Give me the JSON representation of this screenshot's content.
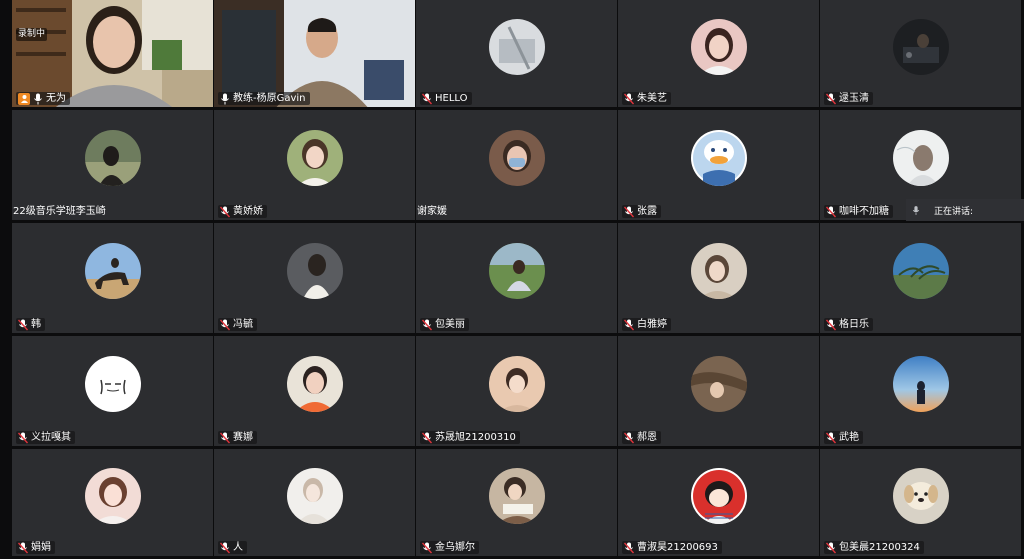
{
  "recording_label": "录制中",
  "speaking_label": "正在讲话:",
  "colors": {
    "tile_bg": "#2c2d30",
    "host_badge": "#f08a24",
    "muted_mic": "#e0343c"
  },
  "participants": [
    {
      "name": "无为",
      "kind": "video",
      "mic": "on",
      "host": true,
      "avatar": "video-woman-bookshelf"
    },
    {
      "name": "教练-杨原Gavin",
      "kind": "video",
      "mic": "on",
      "avatar": "video-man-office"
    },
    {
      "name": "HELLO",
      "kind": "avatar",
      "mic": "muted",
      "avatar": "gray-room"
    },
    {
      "name": "朱美艺",
      "kind": "avatar",
      "mic": "muted",
      "avatar": "woman-portrait"
    },
    {
      "name": "逯玉清",
      "kind": "avatar",
      "mic": "muted",
      "avatar": "dark-night"
    },
    {
      "name": "22级音乐学班李玉崎",
      "kind": "avatar",
      "mic": "none",
      "avatar": "person-outdoor"
    },
    {
      "name": "黄娇娇",
      "kind": "avatar",
      "mic": "muted",
      "avatar": "woman-green"
    },
    {
      "name": "谢家媛",
      "kind": "avatar",
      "mic": "none",
      "avatar": "woman-mask"
    },
    {
      "name": "张露",
      "kind": "avatar",
      "mic": "muted",
      "avatar": "cartoon-duck"
    },
    {
      "name": "咖啡不加糖",
      "kind": "avatar",
      "mic": "muted",
      "avatar": "woman-white"
    },
    {
      "name": "韩",
      "kind": "avatar",
      "mic": "muted",
      "avatar": "horse-rider"
    },
    {
      "name": "冯毓",
      "kind": "avatar",
      "mic": "muted",
      "avatar": "woman-white-2"
    },
    {
      "name": "包美丽",
      "kind": "avatar",
      "mic": "muted",
      "avatar": "grass-field"
    },
    {
      "name": "白雅婷",
      "kind": "avatar",
      "mic": "muted",
      "avatar": "woman-pale"
    },
    {
      "name": "格日乐",
      "kind": "avatar",
      "mic": "muted",
      "avatar": "blue-grass"
    },
    {
      "name": "义拉嘎其",
      "kind": "avatar",
      "mic": "muted",
      "avatar": "white-sketch"
    },
    {
      "name": "赛娜",
      "kind": "avatar",
      "mic": "muted",
      "avatar": "woman-orange"
    },
    {
      "name": "苏晟旭21200310",
      "kind": "avatar",
      "mic": "muted",
      "avatar": "person-peach"
    },
    {
      "name": "郝恩",
      "kind": "avatar",
      "mic": "muted",
      "avatar": "person-brown"
    },
    {
      "name": "武艳",
      "kind": "avatar",
      "mic": "muted",
      "avatar": "sunset-silhouette"
    },
    {
      "name": "娟娟",
      "kind": "avatar",
      "mic": "muted",
      "avatar": "woman-pink"
    },
    {
      "name": "人",
      "kind": "avatar",
      "mic": "muted",
      "avatar": "woman-light"
    },
    {
      "name": "金乌娜尔",
      "kind": "avatar",
      "mic": "muted",
      "avatar": "girl-reading"
    },
    {
      "name": "曹淑昊21200693",
      "kind": "avatar",
      "mic": "muted",
      "avatar": "cartoon-girl"
    },
    {
      "name": "包美晨21200324",
      "kind": "avatar",
      "mic": "muted",
      "avatar": "puppy"
    }
  ]
}
